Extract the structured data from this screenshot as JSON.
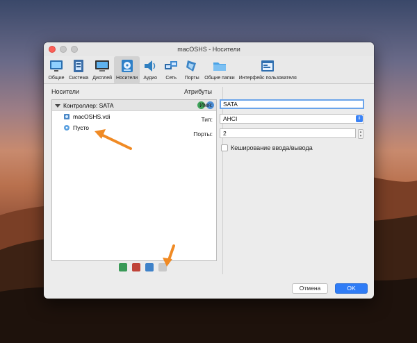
{
  "window": {
    "title": "macOSHS - Носители"
  },
  "toolbar": [
    {
      "id": "general",
      "label": "Общие",
      "icon": "monitor-icon"
    },
    {
      "id": "system",
      "label": "Система",
      "icon": "chip-icon"
    },
    {
      "id": "display",
      "label": "Дисплей",
      "icon": "display-icon"
    },
    {
      "id": "storage",
      "label": "Носители",
      "icon": "disk-icon"
    },
    {
      "id": "audio",
      "label": "Аудио",
      "icon": "speaker-icon"
    },
    {
      "id": "network",
      "label": "Сеть",
      "icon": "network-icon"
    },
    {
      "id": "ports",
      "label": "Порты",
      "icon": "ports-icon"
    },
    {
      "id": "shared",
      "label": "Общие папки",
      "icon": "folder-icon"
    },
    {
      "id": "ui",
      "label": "Интерфейс пользователя",
      "icon": "window-icon"
    }
  ],
  "left": {
    "heading": "Носители",
    "controller": "Контроллер: SATA",
    "items": [
      {
        "label": "macOSHS.vdi",
        "icon": "hard-disk-icon"
      },
      {
        "label": "Пусто",
        "icon": "optical-disc-icon"
      }
    ]
  },
  "attributes": {
    "heading": "Атрибуты",
    "name_label": "Имя:",
    "name_value": "SATA",
    "type_label": "Тип:",
    "type_value": "AHCI",
    "ports_label": "Порты:",
    "ports_value": "2",
    "cache_label": "Кеширование ввода/вывода"
  },
  "buttons": {
    "cancel": "Отмена",
    "ok": "OK"
  },
  "colors": {
    "accent": "#2f7cf6",
    "arrow": "#f08a24"
  }
}
